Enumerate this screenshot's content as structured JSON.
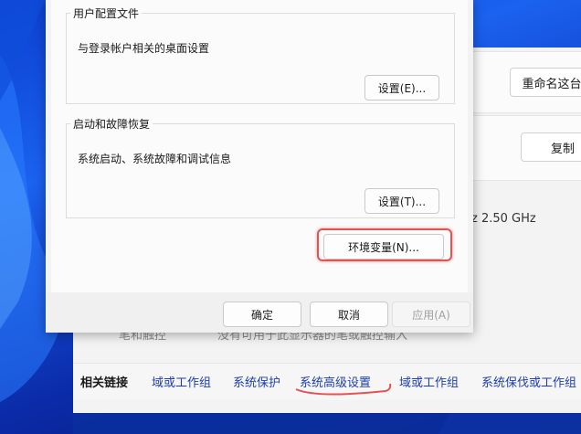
{
  "dialog": {
    "user_profiles": {
      "legend": "用户配置文件",
      "description": "与登录帐户相关的桌面设置",
      "button": "设置(E)..."
    },
    "startup_recovery": {
      "legend": "启动和故障恢复",
      "description": "系统启动、系统故障和调试信息",
      "button": "设置(T)..."
    },
    "env_vars_button": "环境变量(N)...",
    "ok_button": "确定",
    "cancel_button": "取消",
    "apply_button": "应用(A)"
  },
  "background": {
    "rename_button": "重命名这台",
    "copy_button": "复制",
    "spec_value": "z  2.50 GHz",
    "faded_label": "笔和触控",
    "faded_value": "没有可用于此显示器的笔或触控输入",
    "related_links": {
      "heading": "相关链接",
      "items": [
        "域或工作组",
        "系统保护",
        "系统高级设置",
        "域或工作组",
        "系统保伐或工作组"
      ]
    }
  },
  "colors": {
    "highlight": "#e55252",
    "link": "#1f3fa8",
    "wallpaper": "#1b62f0"
  }
}
